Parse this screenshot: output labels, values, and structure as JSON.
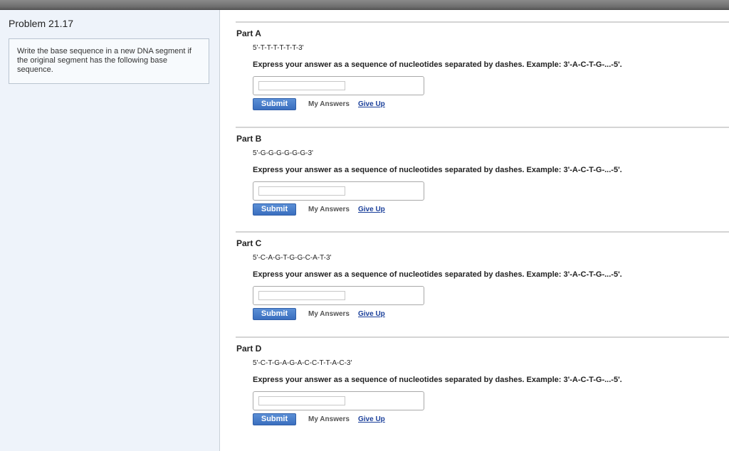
{
  "problem": {
    "title": "Problem 21.17",
    "intro": "Write the base sequence in a new DNA segment if the original segment has the following base sequence."
  },
  "parts": [
    {
      "title": "Part A",
      "sequence": "5'-T-T-T-T-T-T-3'",
      "instruction": "Express your answer as a sequence of nucleotides separated by dashes. Example: 3'-A-C-T-G-...-5'.",
      "answer_value": "",
      "submit_label": "Submit",
      "my_answers_label": "My Answers",
      "give_up_label": "Give Up"
    },
    {
      "title": "Part B",
      "sequence": "5'-G-G-G-G-G-G-3'",
      "instruction": "Express your answer as a sequence of nucleotides separated by dashes. Example: 3'-A-C-T-G-...-5'.",
      "answer_value": "",
      "submit_label": "Submit",
      "my_answers_label": "My Answers",
      "give_up_label": "Give Up"
    },
    {
      "title": "Part C",
      "sequence": "5'-C-A-G-T-G-G-C-A-T-3'",
      "instruction": "Express your answer as a sequence of nucleotides separated by dashes. Example: 3'-A-C-T-G-...-5'.",
      "answer_value": "",
      "submit_label": "Submit",
      "my_answers_label": "My Answers",
      "give_up_label": "Give Up"
    },
    {
      "title": "Part D",
      "sequence": "5'-C-T-G-A-G-A-C-C-T-T-A-C-3'",
      "instruction": "Express your answer as a sequence of nucleotides separated by dashes. Example: 3'-A-C-T-G-...-5'.",
      "answer_value": "",
      "submit_label": "Submit",
      "my_answers_label": "My Answers",
      "give_up_label": "Give Up"
    }
  ],
  "colors": {
    "sidebar_bg": "#eef3fa",
    "submit_button": "#3a6fbf",
    "link": "#1a3f9a"
  }
}
